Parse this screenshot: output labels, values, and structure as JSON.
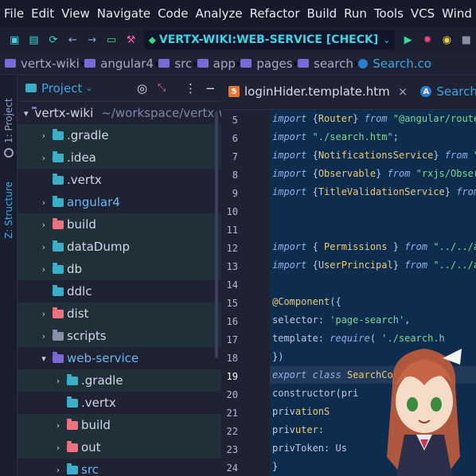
{
  "menu": [
    "File",
    "Edit",
    "View",
    "Navigate",
    "Code",
    "Analyze",
    "Refactor",
    "Build",
    "Run",
    "Tools",
    "VCS",
    "Wind"
  ],
  "run_config": {
    "label": "VERTX-WIKI:WEB-SERVICE [CHECK]"
  },
  "breadcrumbs": [
    "vertx-wiki",
    "angular4",
    "src",
    "app",
    "pages",
    "search",
    "Search.co"
  ],
  "side_tabs": {
    "project": "1: Project",
    "structure": "Z: Structure"
  },
  "project_panel": {
    "title": "Project"
  },
  "tree": [
    {
      "label": "vertx-wiki",
      "extra": "~/workspace/vertx-w",
      "indent": 0,
      "open": true,
      "color": "#7a6ad8",
      "hl": false
    },
    {
      "label": ".gradle",
      "indent": 1,
      "open": false,
      "color": "#3ab0c8",
      "hl": true
    },
    {
      "label": ".idea",
      "indent": 1,
      "open": false,
      "color": "#3ab0c8",
      "hl": true
    },
    {
      "label": ".vertx",
      "indent": 1,
      "noarrow": true,
      "color": "#3ab0c8",
      "hl": false
    },
    {
      "label": "angular4",
      "indent": 1,
      "open": false,
      "color": "#3ab0c8",
      "hl": false,
      "blue": true
    },
    {
      "label": "build",
      "indent": 1,
      "open": false,
      "color": "#f07080",
      "hl": true
    },
    {
      "label": "dataDump",
      "indent": 1,
      "open": false,
      "color": "#3ab0c8",
      "hl": true
    },
    {
      "label": "db",
      "indent": 1,
      "open": false,
      "color": "#3ab0c8",
      "hl": true
    },
    {
      "label": "ddlc",
      "indent": 1,
      "noarrow": true,
      "color": "#3ab0c8",
      "hl": false
    },
    {
      "label": "dist",
      "indent": 1,
      "open": false,
      "color": "#f07080",
      "hl": true
    },
    {
      "label": "scripts",
      "indent": 1,
      "open": false,
      "color": "#8a8fa8",
      "hl": true
    },
    {
      "label": "web-service",
      "indent": 1,
      "open": true,
      "color": "#7a6ad8",
      "hl": false,
      "blue": true
    },
    {
      "label": ".gradle",
      "indent": 2,
      "open": false,
      "color": "#3ab0c8",
      "hl": true
    },
    {
      "label": ".vertx",
      "indent": 2,
      "noarrow": true,
      "color": "#3ab0c8",
      "hl": false
    },
    {
      "label": "build",
      "indent": 2,
      "open": false,
      "color": "#f07080",
      "hl": true
    },
    {
      "label": "out",
      "indent": 2,
      "open": false,
      "color": "#f07080",
      "hl": true
    },
    {
      "label": "src",
      "indent": 2,
      "open": false,
      "color": "#3ab0c8",
      "hl": false,
      "blue": true
    }
  ],
  "tabs": [
    {
      "label": "loginHider.template.htm",
      "icon": "5",
      "iconbg": "#e8742e",
      "close": "×",
      "active": false
    },
    {
      "label": "Search.com",
      "icon": "A",
      "iconbg": "#2a7fd0",
      "active": true
    }
  ],
  "line_numbers": [
    "5",
    "6",
    "7",
    "8",
    "9",
    "10",
    "11",
    "12",
    "13",
    "14",
    "15",
    "16",
    "17",
    "18",
    "19",
    "20",
    "21",
    "22",
    "23",
    "24"
  ],
  "code_lines": [
    [
      [
        "kw",
        "import "
      ],
      [
        "",
        "{"
      ],
      [
        "typ",
        "Router"
      ],
      [
        "",
        "} "
      ],
      [
        "kw",
        "from "
      ],
      [
        "str",
        "\"@angular/router"
      ]
    ],
    [
      [
        "kw",
        "import "
      ],
      [
        "str",
        "\"./search.htm\""
      ],
      [
        "",
        ";"
      ]
    ],
    [
      [
        "kw",
        "import "
      ],
      [
        "",
        "{"
      ],
      [
        "typ",
        "NotificationsService"
      ],
      [
        "",
        "} "
      ],
      [
        "kw",
        "from "
      ],
      [
        "str",
        "\"a"
      ]
    ],
    [
      [
        "kw",
        "import "
      ],
      [
        "",
        "{"
      ],
      [
        "typ",
        "Observable"
      ],
      [
        "",
        "} "
      ],
      [
        "kw",
        "from "
      ],
      [
        "str",
        "\"rxjs/Observ"
      ]
    ],
    [
      [
        "kw",
        "import "
      ],
      [
        "",
        "{"
      ],
      [
        "typ",
        "TitleValidationService"
      ],
      [
        "",
        "} "
      ],
      [
        "kw",
        "from "
      ]
    ],
    [],
    [],
    [
      [
        "kw",
        "import "
      ],
      [
        "",
        "{ "
      ],
      [
        "typ",
        "Permissions"
      ],
      [
        "",
        " } "
      ],
      [
        "kw",
        "from "
      ],
      [
        "str",
        "\"../../au"
      ]
    ],
    [
      [
        "kw",
        "import "
      ],
      [
        "",
        "{"
      ],
      [
        "typ",
        "UserPrincipal"
      ],
      [
        "",
        "} "
      ],
      [
        "kw",
        "from "
      ],
      [
        "str",
        "\"../../au"
      ]
    ],
    [],
    [
      [
        "typ",
        "@Component"
      ],
      [
        "",
        "({"
      ]
    ],
    [
      [
        "",
        "    selector: "
      ],
      [
        "str",
        "'page-search'"
      ],
      [
        "",
        ","
      ]
    ],
    [
      [
        "",
        "    template: "
      ],
      [
        "kw",
        "require"
      ],
      [
        "",
        "( "
      ],
      [
        "str",
        "'./search.h"
      ]
    ],
    [
      [
        "",
        "})"
      ]
    ],
    [
      [
        "kw",
        "export class "
      ],
      [
        "typ",
        "SearchCo"
      ]
    ],
    [
      [
        "",
        "    constructor"
      ],
      [
        "",
        "(pri"
      ]
    ],
    [
      [
        "",
        "           priv"
      ],
      [
        "typ",
        "ationS"
      ]
    ],
    [
      [
        "",
        "           priv"
      ],
      [
        "typ",
        "uter:"
      ]
    ],
    [
      [
        "",
        "           priv"
      ],
      [
        "",
        "Token: Us"
      ]
    ],
    [
      [
        "",
        "    }"
      ]
    ]
  ],
  "colors": {
    "accent": "#38a8e0",
    "run": "#3ad6e3",
    "bg": "#1e2233",
    "editor": "#0e2d4e"
  }
}
